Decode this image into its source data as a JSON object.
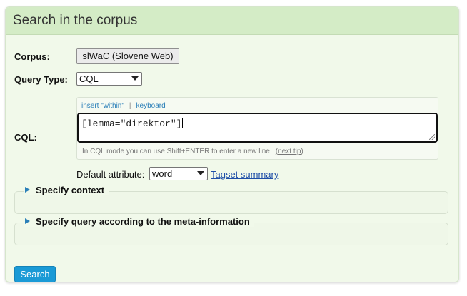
{
  "panel": {
    "title": "Search in the corpus"
  },
  "form": {
    "corpus_label": "Corpus:",
    "corpus_value": "slWaC (Slovene Web)",
    "query_type_label": "Query Type:",
    "query_type_value": "CQL",
    "cql_label": "CQL:",
    "insert_within_link": "insert \"within\"",
    "separator": "|",
    "keyboard_link": "keyboard",
    "cql_value": "[lemma=\"direktor\"]",
    "hint_text": "In CQL mode you can use Shift+ENTER to enter a new line",
    "next_tip_link": "(next tip)",
    "default_attribute_label": "Default attribute:",
    "default_attribute_value": "word",
    "tagset_summary_link": "Tagset summary"
  },
  "sections": {
    "context_label": "Specify context",
    "meta_label": "Specify query according to the meta-information"
  },
  "actions": {
    "search_label": "Search"
  },
  "colors": {
    "header_bg": "#d4ecc6",
    "panel_bg": "#f1f9ea",
    "accent_blue": "#1a9ad6",
    "link_blue": "#1f4fa8"
  },
  "icons": {
    "context_toggle": "triangle-right-icon",
    "meta_toggle": "triangle-right-icon",
    "select_arrow": "chevron-down-icon"
  }
}
